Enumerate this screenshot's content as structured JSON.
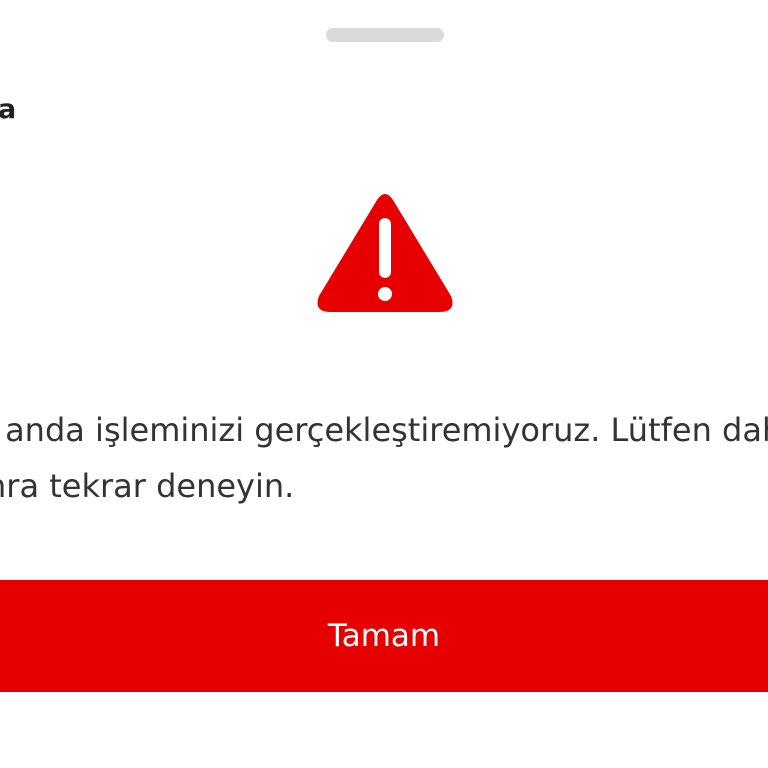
{
  "sheet": {
    "title_fragment": "a"
  },
  "alert": {
    "icon": "warning-triangle-icon",
    "icon_color": "#e60000",
    "message_line_1": "ı anda işleminizi gerçekleştiremiyoruz. Lütfen dah",
    "message_line_2": "nra tekrar deneyin."
  },
  "actions": {
    "ok_label": "Tamam",
    "ok_color": "#e60000"
  }
}
